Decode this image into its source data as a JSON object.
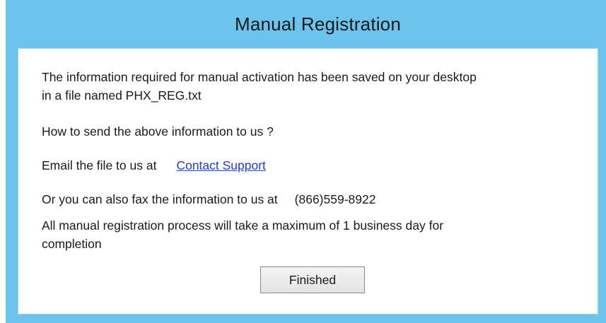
{
  "window": {
    "title": "Manual Registration"
  },
  "body": {
    "saved_line1": "The information required for manual activation has been saved on your desktop",
    "saved_line2": "in a file named PHX_REG.txt",
    "how_to_send": "How to send the above information to us ?",
    "email_prefix": "Email the file  to us at",
    "contact_link": "Contact Support",
    "fax_prefix": "Or you can also fax the information  to us at",
    "fax_number": "(866)559-8922",
    "process_line1": "All manual registration process will take a maximum of 1 business day for",
    "process_line2": "completion"
  },
  "buttons": {
    "finished_label": "Finished"
  },
  "colors": {
    "titlebar_bg": "#6cc3ec",
    "link": "#1f3ccf"
  }
}
